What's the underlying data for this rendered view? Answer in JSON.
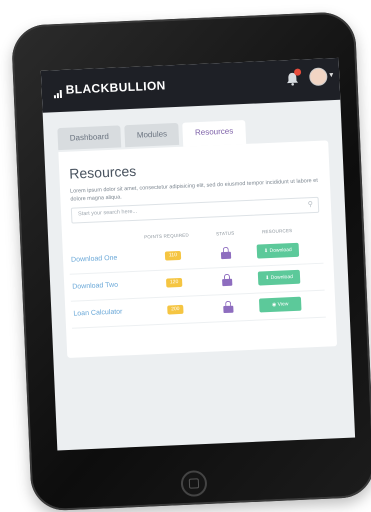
{
  "app": {
    "brand": "BLACKBULLION"
  },
  "header": {
    "notification_icon": "bell-icon",
    "avatar_icon": "avatar-icon",
    "menu_icon": "chevron-down-icon"
  },
  "tabs": [
    {
      "label": "Dashboard",
      "active": false
    },
    {
      "label": "Modules",
      "active": false
    },
    {
      "label": "Resources",
      "active": true
    }
  ],
  "resources": {
    "title": "Resources",
    "description": "Lorem ipsum dolor sit amet, consectetur adipisicing elit, sed do eiusmod tempor incididunt ut labore et dolore magna aliqua.",
    "search_placeholder": "Start your search here...",
    "columns": {
      "points": "POINTS REQUIRED",
      "status": "STATUS",
      "resources": "RESOURCES"
    },
    "rows": [
      {
        "name": "Download One",
        "points": "110",
        "status_icon": "lock-icon",
        "action": "Download"
      },
      {
        "name": "Download Two",
        "points": "120",
        "status_icon": "lock-icon",
        "action": "Download"
      },
      {
        "name": "Loan Calculator",
        "points": "200",
        "status_icon": "lock-icon",
        "action": "View"
      }
    ]
  },
  "colors": {
    "brand_purple": "#8e6dbf",
    "points_yellow": "#f5c542",
    "action_green": "#5cc99a",
    "link_blue": "#6aa8d8"
  }
}
